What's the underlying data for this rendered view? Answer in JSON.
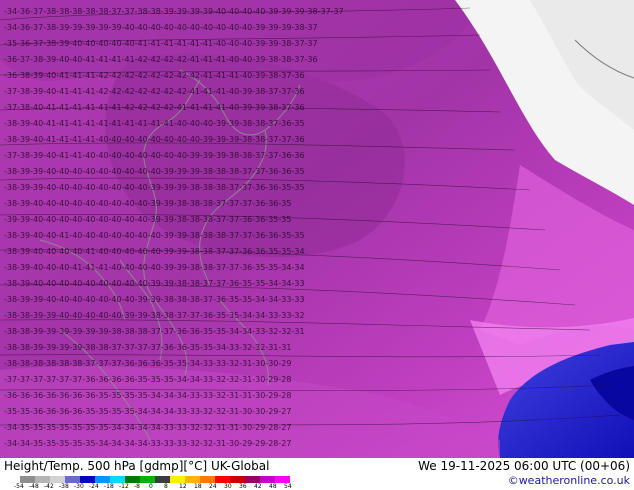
{
  "map": {
    "title_left": "Height/Temp. 500 hPa [gdmp][°C] UK-Global",
    "title_right": "We 19-11-2025 06:00 UTC (00+06)",
    "credit": "©weatheronline.co.uk",
    "colorbar_ticks": [
      "-54",
      "-48",
      "-42",
      "-38",
      "-30",
      "-24",
      "-18",
      "-12",
      "-8",
      "0",
      "8",
      "12",
      "18",
      "24",
      "30",
      "36",
      "42",
      "48",
      "54"
    ],
    "colorbar_colors": [
      "#8e8e8e",
      "#b4b4b4",
      "#d2d2d2",
      "#6a6ac8",
      "#0000c8",
      "#0096ff",
      "#00dcff",
      "#007800",
      "#00b400",
      "#3c3c3c",
      "#fff000",
      "#ffb400",
      "#ff7800",
      "#ff0000",
      "#c80000",
      "#960064",
      "#c800c8",
      "#ff00ff"
    ],
    "regions": {
      "land": "land-area",
      "ocean": "ocean-area",
      "cold_core": "cold-air-core"
    }
  }
}
